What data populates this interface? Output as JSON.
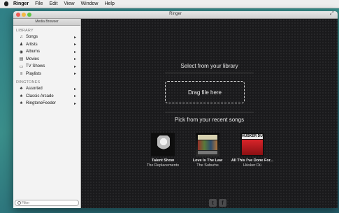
{
  "menubar": {
    "items": [
      "Ringer",
      "File",
      "Edit",
      "View",
      "Window",
      "Help"
    ]
  },
  "window": {
    "title": "Ringer"
  },
  "sidebar": {
    "header": "Media Browser",
    "library_label": "LIBRARY",
    "library_items": [
      {
        "label": "Songs",
        "icon": "music-note-icon"
      },
      {
        "label": "Artists",
        "icon": "person-icon"
      },
      {
        "label": "Albums",
        "icon": "album-icon"
      },
      {
        "label": "Movies",
        "icon": "film-icon"
      },
      {
        "label": "TV Shows",
        "icon": "tv-icon"
      },
      {
        "label": "Playlists",
        "icon": "playlist-icon"
      }
    ],
    "ringtones_label": "RINGTONES",
    "ringtone_items": [
      {
        "label": "Assorted",
        "icon": "bell-icon"
      },
      {
        "label": "Classic Arcade",
        "icon": "bell-icon"
      },
      {
        "label": "RingtoneFeeder",
        "icon": "bell-icon"
      }
    ],
    "search_placeholder": "Filter"
  },
  "main": {
    "select_title": "Select from your library",
    "drop_label": "Drag file here",
    "recent_title": "Pick from your recent songs",
    "recent_songs": [
      {
        "title": "Talent Show",
        "artist": "The Replacements"
      },
      {
        "title": "Love Is The Law",
        "artist": "The Suburbs"
      },
      {
        "title": "All This I've Done For...",
        "artist": "Hüsker Dü"
      }
    ],
    "cover3_text": "HÜSKER DÜ",
    "social": {
      "twitter": "t",
      "facebook": "f"
    }
  },
  "colors": {
    "close": "#ee5b54",
    "minimize": "#f4b942",
    "maximize": "#5ec545",
    "main_bg": "#1a1a1c"
  }
}
